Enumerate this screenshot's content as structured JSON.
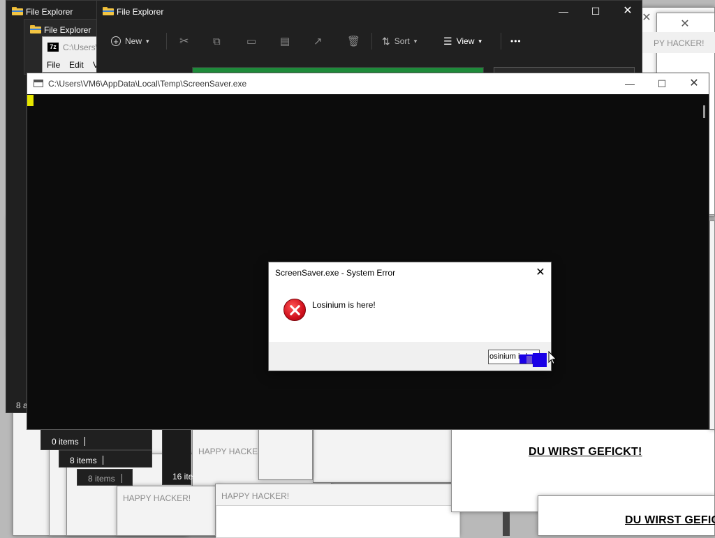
{
  "background_windows": {
    "hacker_title": "HAPPY HACKER!",
    "hacker_title_partial_1": "PY HACKER!",
    "hacker_title_partial_2": "HA",
    "hacker_title_partial_3": "HAPPY HACKER",
    "du_text": "DU WIRST GEFICKT!",
    "du_text_partial": "DU WIRST GEFIC"
  },
  "explorer_back": {
    "title": "File Explorer",
    "status_items": [
      "0 items",
      "8 items",
      "8 items",
      "16 ite",
      "8 a"
    ]
  },
  "explorer_mid": {
    "title": "File Explorer"
  },
  "sevenzip": {
    "path": "C:\\Users\\",
    "menu": [
      "File",
      "Edit",
      "V"
    ]
  },
  "explorer_front": {
    "title": "File Explorer",
    "toolbar": {
      "new_label": "New",
      "sort_label": "Sort",
      "view_label": "View",
      "more_label": "•••"
    }
  },
  "console": {
    "title": "C:\\Users\\VM6\\AppData\\Local\\Temp\\ScreenSaver.exe"
  },
  "dialog": {
    "title": "ScreenSaver.exe - System Error",
    "message": "Losinium is here!",
    "button_label": "osinium is her"
  },
  "colors": {
    "dark_window": "#202020",
    "console_bg": "#0c0c0c",
    "error_red": "#d0101c",
    "cursor_yellow": "#e6e600",
    "glitch_blue": "#1a00e6",
    "progress_green": "#1e8a3a"
  },
  "icons": {
    "window_close": "close-icon",
    "window_max": "maximize-icon",
    "window_min": "minimize-icon",
    "folder": "folder-icon",
    "error": "error-icon"
  }
}
